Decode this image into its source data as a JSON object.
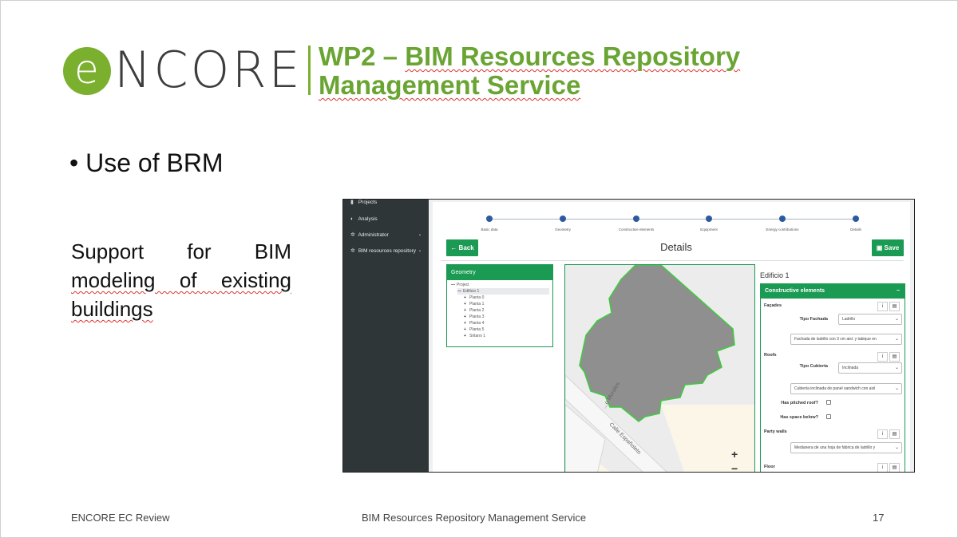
{
  "logo": {
    "circle_letter": "e",
    "word": "NCORE"
  },
  "title": {
    "prefix": "WP2 – ",
    "line1": "BIM Resources Repository",
    "line2": "Management Service"
  },
  "bullet": "• Use of BRM",
  "support": {
    "line1": "Support   for   BIM",
    "line2": "modeling of existing",
    "line3": "buildings"
  },
  "footer": {
    "left": "ENCORE EC Review",
    "center": "BIM Resources Repository Management Service",
    "page": "17"
  },
  "app": {
    "sidebar": [
      {
        "icon": "projects-icon",
        "glyph": "▮",
        "label": "Projects",
        "chevron": ""
      },
      {
        "icon": "analysis-icon",
        "glyph": "◐",
        "label": "Analysis",
        "chevron": ""
      },
      {
        "icon": "gear-icon",
        "glyph": "✲",
        "label": "Administrator",
        "chevron": "‹"
      },
      {
        "icon": "gear-icon",
        "glyph": "✲",
        "label": "BIM resources repository",
        "chevron": "‹"
      }
    ],
    "steps": [
      "Basic data",
      "Geometry",
      "Constructive elements",
      "Equipment",
      "Energy contributions",
      "Details"
    ],
    "back_label": "Back",
    "save_label": "Save",
    "page_title": "Details",
    "geometry": {
      "header": "Geometry",
      "tree": [
        {
          "mark": "—",
          "label": "Project"
        },
        {
          "mark": "—",
          "label": "Edificio 1"
        },
        {
          "mark": "+",
          "label": "Planta 0"
        },
        {
          "mark": "+",
          "label": "Planta 1"
        },
        {
          "mark": "+",
          "label": "Planta 2"
        },
        {
          "mark": "+",
          "label": "Planta 3"
        },
        {
          "mark": "+",
          "label": "Planta 4"
        },
        {
          "mark": "+",
          "label": "Planta 5"
        },
        {
          "mark": "+",
          "label": "Sótano 1"
        }
      ]
    },
    "map": {
      "street1": "Calle Españoleto",
      "street2": "...o Morales",
      "zoom_in": "+",
      "zoom_out": "−"
    },
    "building_name": "Edificio 1",
    "constructive": {
      "header": "Constructive elements",
      "facades_label": "Façades",
      "tipo_fachada_label": "Tipo Fachada",
      "tipo_fachada_value": "Ladrillo",
      "fachada_detail": "Fachada de ladrillo con 3 cm aisl. y tabique en",
      "roofs_label": "Roofs",
      "tipo_cubierta_label": "Tipo Cubierta",
      "tipo_cubierta_value": "Inclinada",
      "cubierta_detail": "Cubierta inclinada de panel sandwich con aisl",
      "pitched_label": "Has pitched roof?",
      "space_label": "Has space below?",
      "party_walls_label": "Party walls",
      "party_detail": "Medianera de una hoja de fábrica de ladrillo y",
      "floor_label": "Floor"
    }
  }
}
